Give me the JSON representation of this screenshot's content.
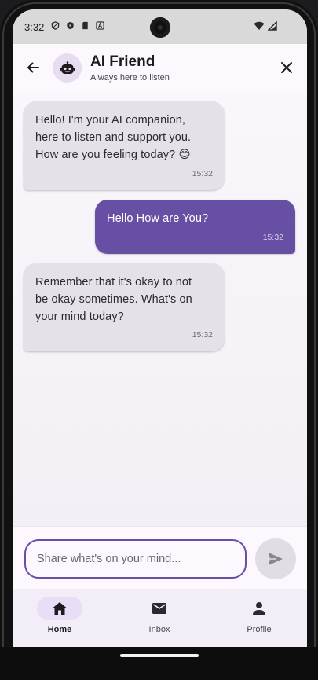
{
  "status_bar": {
    "time": "3:32",
    "left_icons": [
      "shield-icon",
      "play-protect-icon",
      "sd-card-icon",
      "font-a-icon"
    ],
    "right_icons": [
      "wifi-icon",
      "cellular-signal-icon"
    ]
  },
  "header": {
    "title": "AI Friend",
    "subtitle": "Always here to listen",
    "back_icon": "arrow-back-icon",
    "avatar_icon": "robot-icon",
    "close_icon": "close-icon"
  },
  "messages": [
    {
      "sender": "ai",
      "text": "Hello! I'm your AI companion,\nhere to listen and support you.\nHow are you feeling today? 😊",
      "time": "15:32"
    },
    {
      "sender": "user",
      "text": "Hello How are You?",
      "time": "15:32"
    },
    {
      "sender": "ai",
      "text": "Remember that it's okay to not\nbe okay sometimes. What's on\nyour mind today?",
      "time": "15:32"
    }
  ],
  "input": {
    "placeholder": "Share what's on your mind...",
    "value": "",
    "send_icon": "send-icon"
  },
  "nav": {
    "items": [
      {
        "label": "Home",
        "icon": "home-icon",
        "active": true
      },
      {
        "label": "Inbox",
        "icon": "mail-icon",
        "active": false
      },
      {
        "label": "Profile",
        "icon": "person-icon",
        "active": false
      }
    ]
  },
  "colors": {
    "primary": "#6750a4",
    "ai_bubble": "#e6e0e9",
    "nav_active_pill": "#e8def8",
    "background": "#fdf7fe"
  }
}
